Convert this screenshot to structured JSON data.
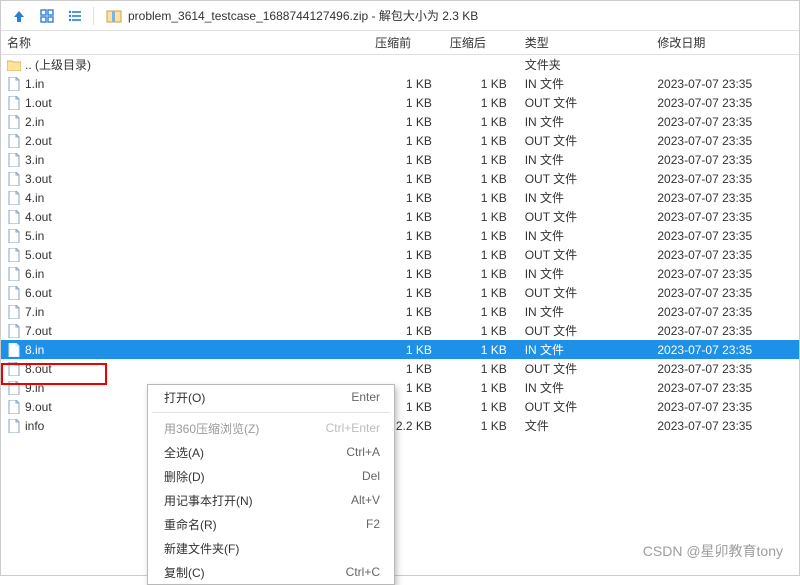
{
  "toolbar": {
    "title": "problem_3614_testcase_1688744127496.zip - 解包大小为 2.3 KB"
  },
  "columns": {
    "name": "名称",
    "before": "压缩前",
    "after": "压缩后",
    "type": "类型",
    "date": "修改日期"
  },
  "parent_row": {
    "name": ".. (上级目录)",
    "type": "文件夹"
  },
  "files": [
    {
      "name": "1.in",
      "before": "1 KB",
      "after": "1 KB",
      "type": "IN 文件",
      "date": "2023-07-07 23:35",
      "kind": "file"
    },
    {
      "name": "1.out",
      "before": "1 KB",
      "after": "1 KB",
      "type": "OUT 文件",
      "date": "2023-07-07 23:35",
      "kind": "file"
    },
    {
      "name": "2.in",
      "before": "1 KB",
      "after": "1 KB",
      "type": "IN 文件",
      "date": "2023-07-07 23:35",
      "kind": "file"
    },
    {
      "name": "2.out",
      "before": "1 KB",
      "after": "1 KB",
      "type": "OUT 文件",
      "date": "2023-07-07 23:35",
      "kind": "file"
    },
    {
      "name": "3.in",
      "before": "1 KB",
      "after": "1 KB",
      "type": "IN 文件",
      "date": "2023-07-07 23:35",
      "kind": "file"
    },
    {
      "name": "3.out",
      "before": "1 KB",
      "after": "1 KB",
      "type": "OUT 文件",
      "date": "2023-07-07 23:35",
      "kind": "file"
    },
    {
      "name": "4.in",
      "before": "1 KB",
      "after": "1 KB",
      "type": "IN 文件",
      "date": "2023-07-07 23:35",
      "kind": "file"
    },
    {
      "name": "4.out",
      "before": "1 KB",
      "after": "1 KB",
      "type": "OUT 文件",
      "date": "2023-07-07 23:35",
      "kind": "file"
    },
    {
      "name": "5.in",
      "before": "1 KB",
      "after": "1 KB",
      "type": "IN 文件",
      "date": "2023-07-07 23:35",
      "kind": "file"
    },
    {
      "name": "5.out",
      "before": "1 KB",
      "after": "1 KB",
      "type": "OUT 文件",
      "date": "2023-07-07 23:35",
      "kind": "file"
    },
    {
      "name": "6.in",
      "before": "1 KB",
      "after": "1 KB",
      "type": "IN 文件",
      "date": "2023-07-07 23:35",
      "kind": "file"
    },
    {
      "name": "6.out",
      "before": "1 KB",
      "after": "1 KB",
      "type": "OUT 文件",
      "date": "2023-07-07 23:35",
      "kind": "file"
    },
    {
      "name": "7.in",
      "before": "1 KB",
      "after": "1 KB",
      "type": "IN 文件",
      "date": "2023-07-07 23:35",
      "kind": "file"
    },
    {
      "name": "7.out",
      "before": "1 KB",
      "after": "1 KB",
      "type": "OUT 文件",
      "date": "2023-07-07 23:35",
      "kind": "file"
    },
    {
      "name": "8.in",
      "before": "1 KB",
      "after": "1 KB",
      "type": "IN 文件",
      "date": "2023-07-07 23:35",
      "kind": "file",
      "selected": true
    },
    {
      "name": "8.out",
      "before": "1 KB",
      "after": "1 KB",
      "type": "OUT 文件",
      "date": "2023-07-07 23:35",
      "kind": "file"
    },
    {
      "name": "9.in",
      "before": "1 KB",
      "after": "1 KB",
      "type": "IN 文件",
      "date": "2023-07-07 23:35",
      "kind": "file"
    },
    {
      "name": "9.out",
      "before": "1 KB",
      "after": "1 KB",
      "type": "OUT 文件",
      "date": "2023-07-07 23:35",
      "kind": "file"
    },
    {
      "name": "info",
      "before": "2.2 KB",
      "after": "1 KB",
      "type": "文件",
      "date": "2023-07-07 23:35",
      "kind": "file"
    }
  ],
  "menu": {
    "open": {
      "label": "打开(O)",
      "shortcut": "Enter"
    },
    "browse360": {
      "label": "用360压缩浏览(Z)",
      "shortcut": "Ctrl+Enter",
      "disabled": true
    },
    "select_all": {
      "label": "全选(A)",
      "shortcut": "Ctrl+A"
    },
    "delete": {
      "label": "删除(D)",
      "shortcut": "Del"
    },
    "notepad": {
      "label": "用记事本打开(N)",
      "shortcut": "Alt+V"
    },
    "rename": {
      "label": "重命名(R)",
      "shortcut": "F2"
    },
    "new_folder": {
      "label": "新建文件夹(F)",
      "shortcut": ""
    },
    "copy": {
      "label": "复制(C)",
      "shortcut": "Ctrl+C"
    }
  },
  "watermark": "CSDN @星卯教育tony"
}
